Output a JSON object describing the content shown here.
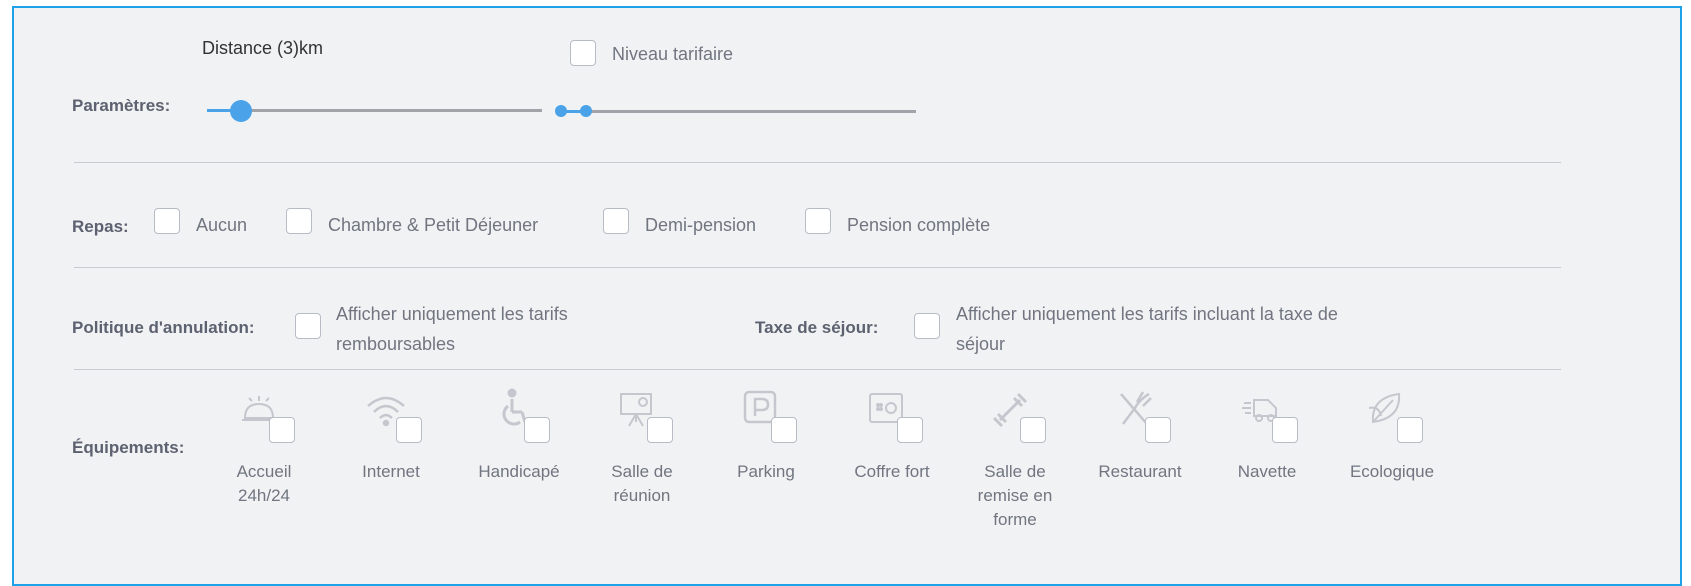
{
  "parametres": {
    "label": "Paramètres:",
    "distance_label": "Distance (3)km",
    "distance_value_km": 3,
    "niveau_tarifaire_label": "Niveau tarifaire"
  },
  "repas": {
    "label": "Repas:",
    "options": [
      "Aucun",
      "Chambre & Petit Déjeuner",
      "Demi-pension",
      "Pension complète"
    ]
  },
  "politique": {
    "label": "Politique d'annulation:",
    "option_line1": "Afficher uniquement les tarifs",
    "option_line2": "remboursables"
  },
  "taxe": {
    "label": "Taxe de séjour:",
    "option_line1": "Afficher uniquement les tarifs incluant la taxe de",
    "option_line2": "séjour"
  },
  "equipements": {
    "label": "Équipements:",
    "items": [
      {
        "icon": "reception-bell-icon",
        "lines": [
          "Accueil",
          "24h/24"
        ]
      },
      {
        "icon": "wifi-icon",
        "lines": [
          "Internet"
        ]
      },
      {
        "icon": "wheelchair-icon",
        "lines": [
          "Handicapé"
        ]
      },
      {
        "icon": "presentation-board-icon",
        "lines": [
          "Salle de",
          "réunion"
        ]
      },
      {
        "icon": "parking-icon",
        "lines": [
          "Parking"
        ]
      },
      {
        "icon": "safe-icon",
        "lines": [
          "Coffre fort"
        ]
      },
      {
        "icon": "dumbbell-icon",
        "lines": [
          "Salle de",
          "remise en",
          "forme"
        ]
      },
      {
        "icon": "fork-knife-icon",
        "lines": [
          "Restaurant"
        ]
      },
      {
        "icon": "shuttle-icon",
        "lines": [
          "Navette"
        ]
      },
      {
        "icon": "leaf-icon",
        "lines": [
          "Ecologique"
        ]
      }
    ]
  }
}
